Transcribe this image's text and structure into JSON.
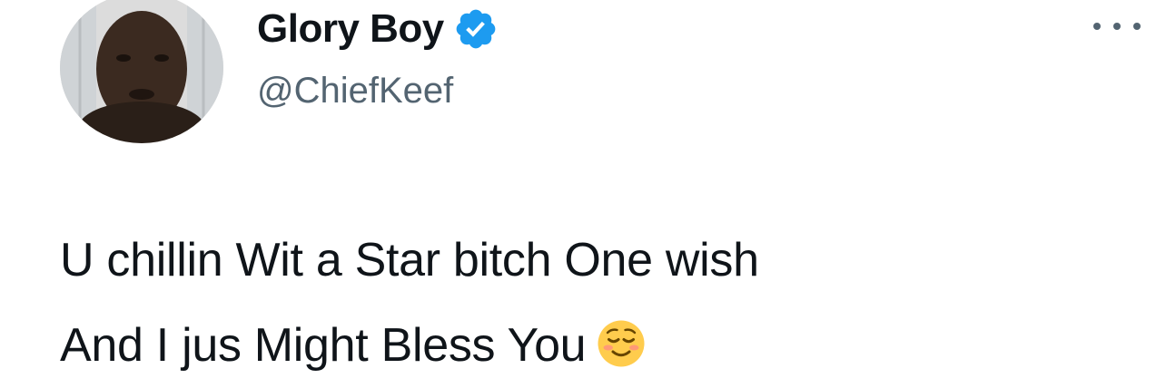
{
  "tweet": {
    "author": {
      "display_name": "Glory Boy",
      "handle": "@ChiefKeef",
      "verified": true,
      "verified_icon": "verified-badge-icon",
      "avatar_icon": "avatar-photo"
    },
    "text_lines": [
      "U chillin Wit a Star bitch One wish",
      "And I jus Might Bless You"
    ],
    "emoji": "relieved-face-emoji",
    "more_icon": "more-options-icon"
  },
  "colors": {
    "text": "#0f1419",
    "secondary_text": "#536471",
    "verified_blue": "#1d9bf0",
    "background": "#ffffff"
  }
}
